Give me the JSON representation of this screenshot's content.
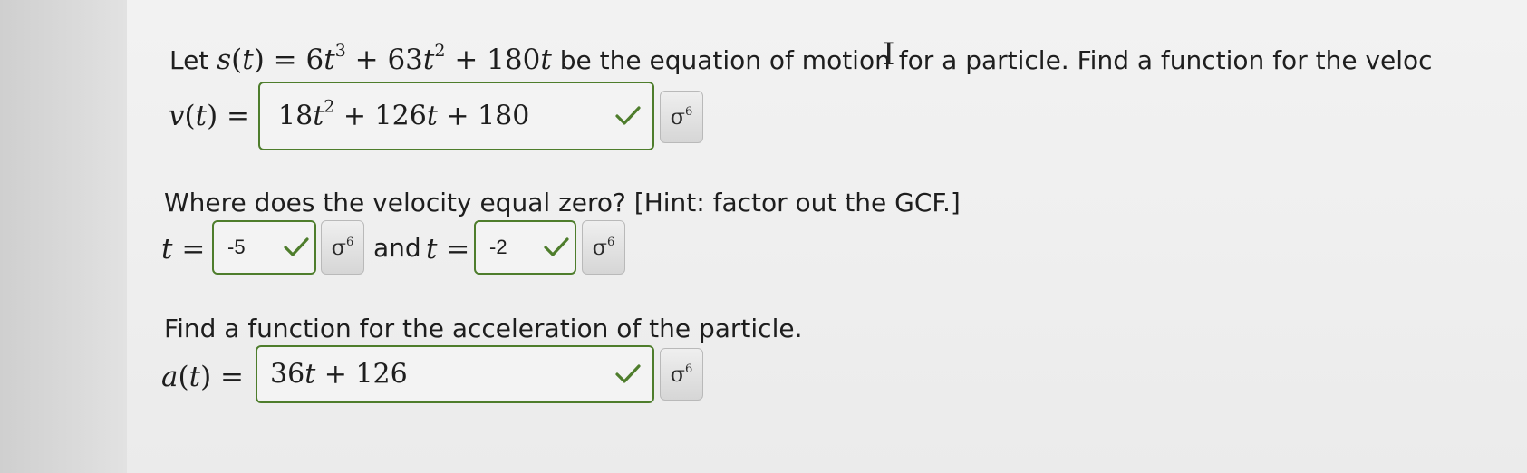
{
  "question1": {
    "prefix": "Let ",
    "equation_s": "s(t) = 6t³ + 63t² + 180t",
    "suffix": " be the equation of motion for a particle. Find a function for the veloc"
  },
  "velocity": {
    "label": "v(t) =",
    "answer": "18t² + 126t + 180",
    "status": "correct"
  },
  "question2": {
    "text": "Where does the velocity equal zero? [Hint: factor out the GCF.]",
    "t_label": "t =",
    "and_label": "and",
    "answer1": "-5",
    "answer2": "-2"
  },
  "question3": {
    "text": "Find a function for the acceleration of the particle."
  },
  "acceleration": {
    "label": "a(t) =",
    "answer": "36t + 126",
    "status": "correct"
  },
  "icons": {
    "check": "check-icon",
    "symbol": "sigma-symbol-icon"
  },
  "colors": {
    "correct_green": "#4e7d2c",
    "page_bg": "#efefef"
  }
}
